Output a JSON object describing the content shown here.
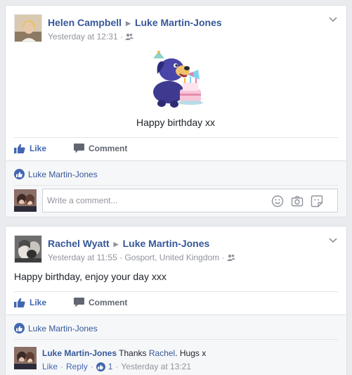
{
  "posts": [
    {
      "author": "Helen Campbell",
      "target": "Luke Martin-Jones",
      "time": "Yesterday at 12:31",
      "separator": "·",
      "text": "Happy birthday xx",
      "actions": {
        "like": "Like",
        "comment": "Comment"
      },
      "reaction_name": "Luke Martin-Jones",
      "comment_placeholder": "Write a comment..."
    },
    {
      "author": "Rachel Wyatt",
      "target": "Luke Martin-Jones",
      "time": "Yesterday at 11:55",
      "location": "Gosport, United Kingdom",
      "separator": "·",
      "text": "Happy birthday, enjoy your day xxx",
      "actions": {
        "like": "Like",
        "comment": "Comment"
      },
      "reaction_name": "Luke Martin-Jones",
      "reply": {
        "author": "Luke Martin-Jones",
        "text_before": "Thanks",
        "mention": "Rachel",
        "text_after": ". Hugs x",
        "like": "Like",
        "reply": "Reply",
        "like_count": "1",
        "time": "Yesterday at 13:21",
        "separator": "·"
      }
    }
  ],
  "colors": {
    "link": "#365899",
    "like_blue": "#4267b2",
    "meta_gray": "#90949c",
    "background": "#e9ebee"
  },
  "icons": [
    "friends-icon",
    "like-thumb-icon",
    "comment-bubble-icon",
    "emoji-icon",
    "camera-icon",
    "sticker-icon",
    "chevron-down-icon",
    "birthday-dog-sticker"
  ]
}
